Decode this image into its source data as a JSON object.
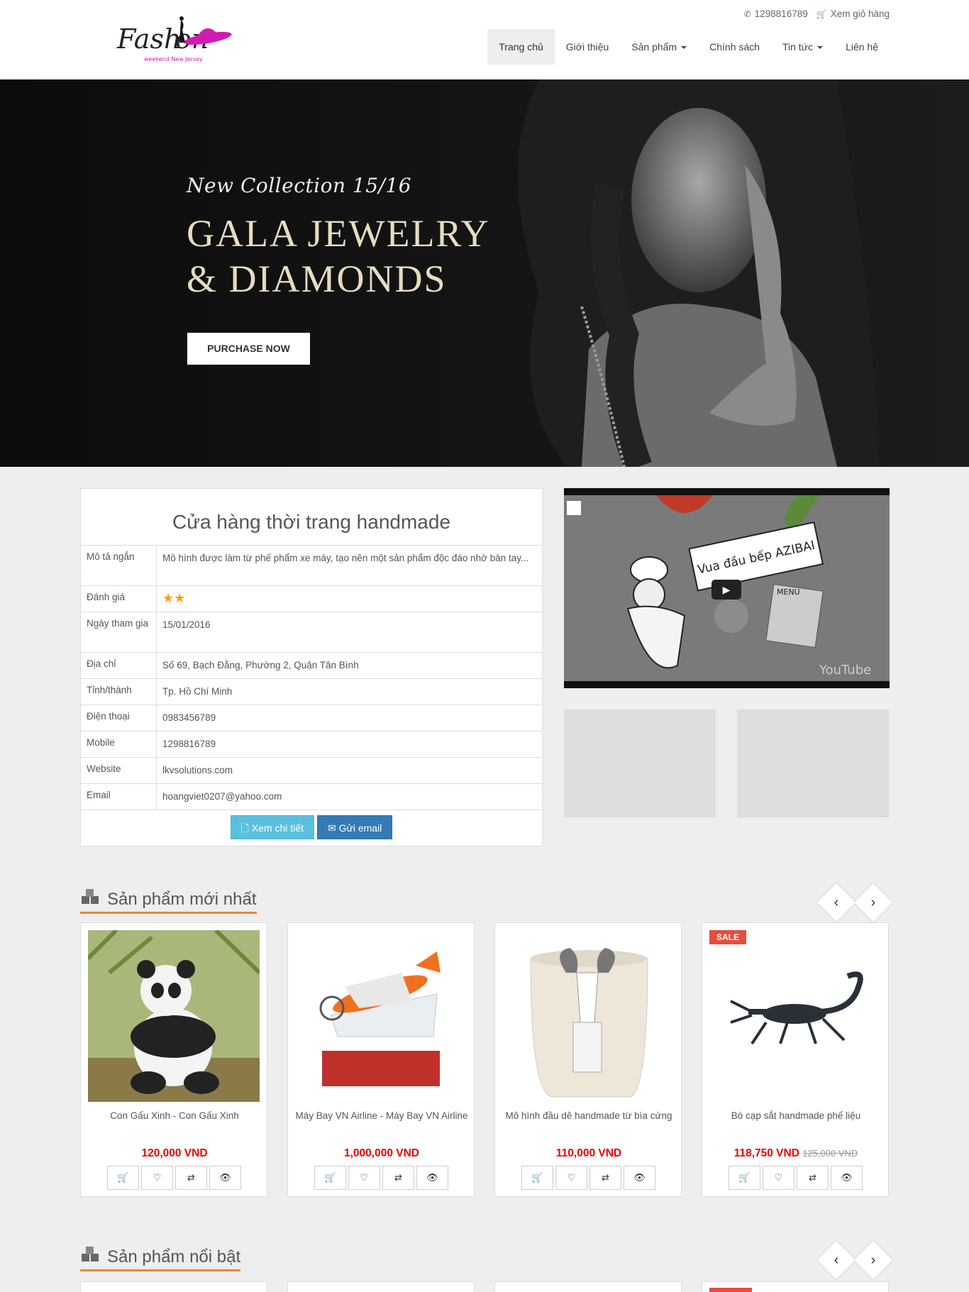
{
  "header": {
    "phone": "1298816789",
    "cart_label": "Xem giỏ hàng",
    "nav": [
      "Trang chủ",
      "Giới thiệu",
      "Sản phẩm",
      "Chính sách",
      "Tin tức",
      "Liên hệ"
    ]
  },
  "logo": {
    "text": "Fashion",
    "tagline": "weekend New Jersey"
  },
  "hero": {
    "subtitle": "New Collection 15/16",
    "title_line1": "GALA JEWELRY",
    "title_line2": "& DIAMONDS",
    "button": "PURCHASE NOW"
  },
  "shop": {
    "title": "Cửa hàng thời trang handmade",
    "rows": [
      {
        "k": "Mô tả ngắn",
        "v": "Mô hình được làm từ phế phẩm xe máy, tạo nên một sản phẩm độc đáo nhờ bàn tay..."
      },
      {
        "k": "Đánh giá",
        "v": ""
      },
      {
        "k": "Ngày tham gia",
        "v": "15/01/2016"
      },
      {
        "k": "Địa chỉ",
        "v": "Số 69, Bạch Đằng, Phường 2, Quận Tân Bình"
      },
      {
        "k": "Tỉnh/thành",
        "v": "Tp. Hồ Chí Minh"
      },
      {
        "k": "Điện thoại",
        "v": "0983456789"
      },
      {
        "k": "Mobile",
        "v": "1298816789"
      },
      {
        "k": "Website",
        "v": "lkvsolutions.com"
      },
      {
        "k": "Email",
        "v": "hoangviet0207@yahoo.com"
      }
    ],
    "rating": 2,
    "btn_detail": "Xem chi tiết",
    "btn_email": "Gửi email"
  },
  "video": {
    "sign": "Vua đầu bếp AZIBAI",
    "menu": "MENU",
    "brand": "YouTube"
  },
  "new_products": {
    "title": "Sản phẩm mới nhất",
    "items": [
      {
        "name": "Con Gấu Xinh - Con Gấu Xinh",
        "price": "120,000 VND",
        "old": ""
      },
      {
        "name": "Máy Bay VN Airline - Máy Bay VN Airline",
        "price": "1,000,000 VND",
        "old": ""
      },
      {
        "name": "Mô hình đầu dê handmade từ bìa cứng",
        "price": "110,000 VND",
        "old": ""
      },
      {
        "name": "Bò cạp sắt handmade phế liệu",
        "price": "118,750 VND",
        "old": "125,000 VND",
        "badge": "SALE"
      }
    ]
  },
  "featured": {
    "title": "Sản phẩm nổi bật"
  },
  "colors": {
    "accent": "#e8873a",
    "price": "#ee0000",
    "sale": "#e74c3c",
    "info_btn": "#5bc0de",
    "primary_btn": "#337ab7"
  }
}
